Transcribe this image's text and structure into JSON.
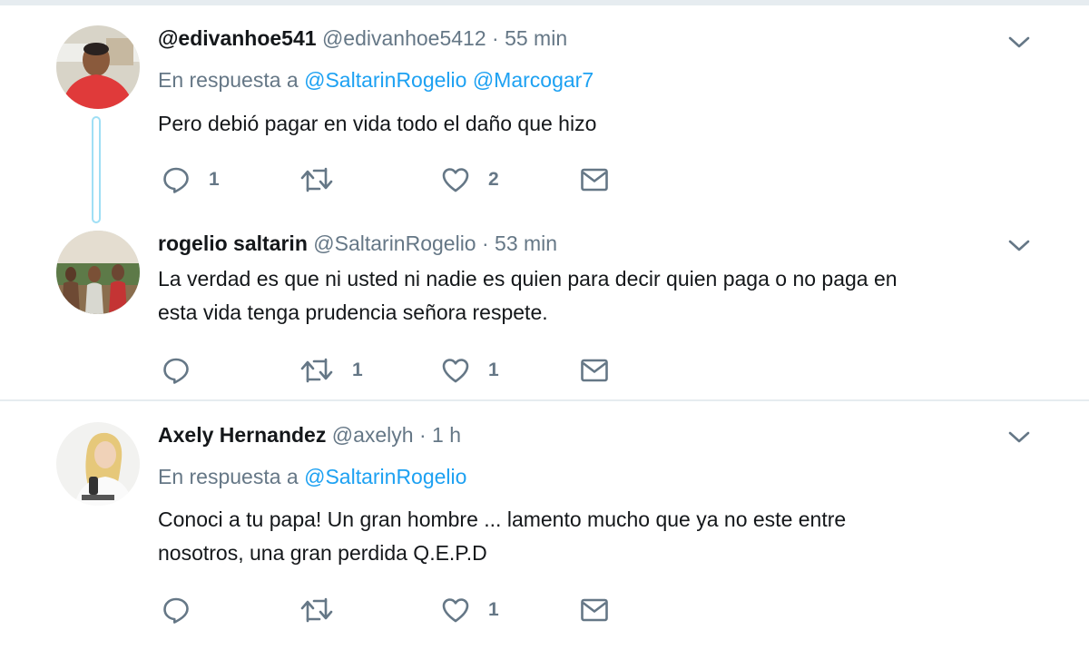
{
  "tweets": [
    {
      "name": "@edivanhoe541",
      "handle": "@edivanhoe5412",
      "dot": "·",
      "time": "55 min",
      "reply_prefix": "En respuesta a",
      "reply_mentions": [
        "@SaltarinRogelio",
        "@Marcogar7"
      ],
      "body": [
        "Pero debió pagar en vida todo el daño que hizo"
      ],
      "replies": "1",
      "retweets": "",
      "likes": "2"
    },
    {
      "name": "rogelio saltarin",
      "handle": "@SaltarinRogelio",
      "dot": "·",
      "time": "53 min",
      "body": [
        "La verdad es que ni usted ni nadie es quien para decir quien paga o no paga en",
        "esta vida tenga prudencia señora respete."
      ],
      "replies": "",
      "retweets": "1",
      "likes": "1"
    },
    {
      "name": "Axely Hernandez",
      "handle": "@axelyh",
      "dot": "·",
      "time": "1 h",
      "reply_prefix": "En respuesta a",
      "reply_mentions": [
        "@SaltarinRogelio"
      ],
      "body": [
        "Conoci a tu papa! Un gran hombre ... lamento mucho que ya no este entre",
        "nosotros, una gran perdida Q.E.P.D"
      ],
      "replies": "",
      "retweets": "",
      "likes": "1"
    }
  ],
  "colors": {
    "link": "#1da1f2",
    "secondary_text": "#657786",
    "icon": "#657786",
    "thread_line": "#9fdff5",
    "divider": "#e6ecf0"
  },
  "icons": {
    "reply": "reply-icon",
    "retweet": "retweet-icon",
    "like": "heart-icon",
    "dm": "envelope-icon",
    "menu": "chevron-down-icon"
  }
}
